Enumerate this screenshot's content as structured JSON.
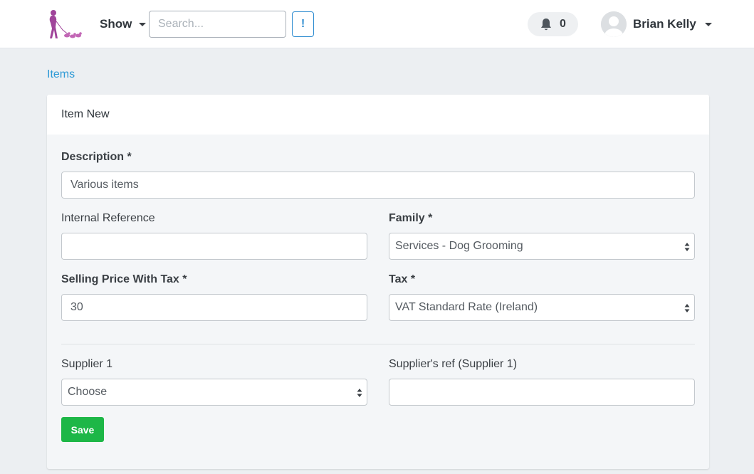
{
  "header": {
    "show_label": "Show",
    "search_placeholder": "Search...",
    "alert_label": "!",
    "notifications_count": "0",
    "user_name": "Brian Kelly"
  },
  "breadcrumb": "Items",
  "card": {
    "title": "Item New"
  },
  "form": {
    "description": {
      "label": "Description *",
      "value": "Various items"
    },
    "internal_reference": {
      "label": "Internal Reference",
      "value": ""
    },
    "family": {
      "label": "Family *",
      "value": "Services - Dog Grooming"
    },
    "selling_price": {
      "label": "Selling Price With Tax *",
      "value": "30"
    },
    "tax": {
      "label": "Tax *",
      "value": "VAT Standard Rate (Ireland)"
    },
    "supplier1": {
      "label": "Supplier 1",
      "value": "Choose"
    },
    "supplier_ref": {
      "label": "Supplier's ref (Supplier 1)",
      "value": ""
    },
    "save_label": "Save"
  },
  "colors": {
    "accent": "#2e9ad6",
    "save": "#1db747",
    "logo": "#a0449a"
  },
  "icons": [
    "logo-icon",
    "bell-icon",
    "user-avatar-icon",
    "chevron-down-icon",
    "select-arrows-icon"
  ]
}
